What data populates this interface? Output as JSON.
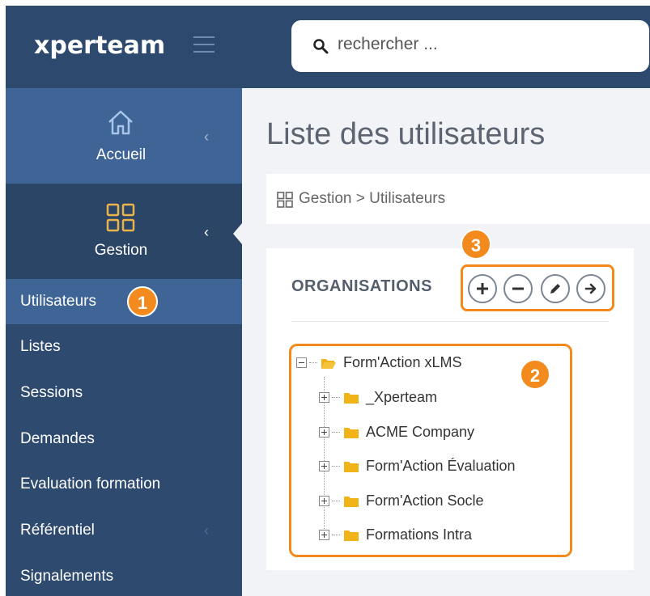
{
  "brand": {
    "logo_text": "xperteam"
  },
  "search": {
    "placeholder": "rechercher ..."
  },
  "nav": {
    "home_label": "Accueil",
    "gestion_label": "Gestion"
  },
  "menu": {
    "items": [
      {
        "label": "Utilisateurs"
      },
      {
        "label": "Listes"
      },
      {
        "label": "Sessions"
      },
      {
        "label": "Demandes"
      },
      {
        "label": "Evaluation formation"
      },
      {
        "label": "Référentiel"
      },
      {
        "label": "Signalements"
      }
    ]
  },
  "page": {
    "title": "Liste des utilisateurs"
  },
  "breadcrumb": {
    "text": "Gestion > Utilisateurs"
  },
  "organisations": {
    "title": "ORGANISATIONS",
    "actions": [
      "add-icon",
      "remove-icon",
      "edit-icon",
      "arrow-right-icon"
    ]
  },
  "tree": {
    "root": "Form'Action xLMS",
    "children": [
      {
        "label": "_Xperteam"
      },
      {
        "label": "ACME Company"
      },
      {
        "label": "Form'Action Évaluation"
      },
      {
        "label": "Form'Action Socle"
      },
      {
        "label": "Formations Intra"
      }
    ]
  },
  "callouts": {
    "one": "1",
    "two": "2",
    "three": "3"
  },
  "colors": {
    "sidebar": "#2e4a6f",
    "active": "#3e6596",
    "accent": "#f28a1e",
    "gestion_icon": "#e9b44c",
    "folder": "#f0b418"
  }
}
